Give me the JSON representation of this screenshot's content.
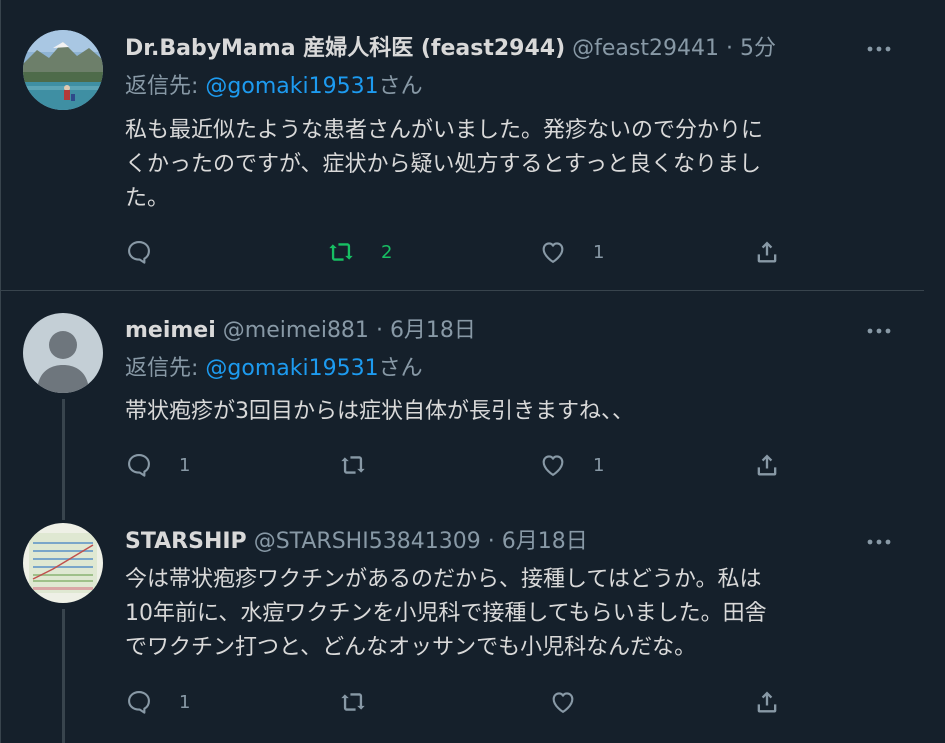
{
  "colors": {
    "background": "#15202b",
    "text": "#d9d9d9",
    "muted": "#8899a6",
    "link": "#1d9bf0",
    "retweeted": "#17bf63",
    "border": "#38444d"
  },
  "tweets": [
    {
      "name": "Dr.BabyMama 産婦人科医 (feast2944)",
      "handle": "@feast29441",
      "separator": "·",
      "time": "5分",
      "reply_prefix": "返信先: ",
      "reply_to": "@gomaki19531",
      "reply_suffix": "さん",
      "text_lines": [
        "私も最近似たような患者さんがいました。発疹ないので分かりに",
        "くかったのですが、症状から疑い処方するとすっと良くなりまし",
        "た。"
      ],
      "replies": "",
      "retweets": "2",
      "likes": "1",
      "retweeted": true,
      "avatar_icon": "landscape-photo-avatar"
    },
    {
      "name": "meimei",
      "handle": "@meimei881",
      "separator": "·",
      "time": "6月18日",
      "reply_prefix": "返信先: ",
      "reply_to": "@gomaki19531",
      "reply_suffix": "さん",
      "text_lines": [
        "帯状疱疹が3回目からは症状自体が長引きますね、、"
      ],
      "replies": "1",
      "retweets": "",
      "likes": "1",
      "retweeted": false,
      "avatar_icon": "default-user-avatar"
    },
    {
      "name": "STARSHIP",
      "handle": "@STARSHI53841309",
      "separator": "·",
      "time": "6月18日",
      "text_lines": [
        "今は帯状疱疹ワクチンがあるのだから、接種してはどうか。私は",
        "10年前に、水痘ワクチンを小児科で接種してもらいました。田舎",
        "でワクチン打つと、どんなオッサンでも小児科なんだな。"
      ],
      "replies": "1",
      "retweets": "",
      "likes": "",
      "retweeted": false,
      "avatar_icon": "chart-image-avatar"
    }
  ]
}
